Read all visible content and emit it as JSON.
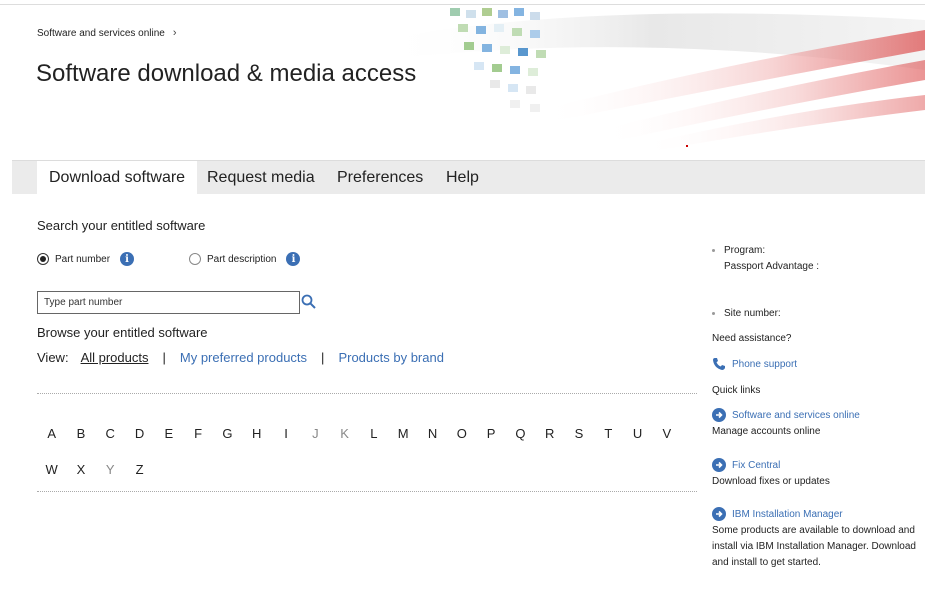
{
  "header": {
    "breadcrumb": "Software and services online",
    "title": "Software download & media access"
  },
  "tabs": [
    {
      "label": "Download software",
      "active": true
    },
    {
      "label": "Request media"
    },
    {
      "label": "Preferences"
    },
    {
      "label": "Help"
    }
  ],
  "search": {
    "heading": "Search your entitled software",
    "options": [
      {
        "label": "Part number",
        "selected": true
      },
      {
        "label": "Part description",
        "selected": false
      }
    ],
    "placeholder": "Type part number"
  },
  "browse": {
    "heading": "Browse your entitled software",
    "view_label": "View:",
    "views": [
      "All products",
      "My preferred products",
      "Products by brand"
    ],
    "letters_row1": [
      "A",
      "B",
      "C",
      "D",
      "E",
      "F",
      "G",
      "H",
      "I",
      "J",
      "K",
      "L",
      "M",
      "N",
      "O",
      "P",
      "Q",
      "R",
      "S",
      "T",
      "U",
      "V"
    ],
    "letters_row2": [
      "W",
      "X",
      "Y",
      "Z"
    ]
  },
  "sidebar": {
    "program_label": "Program:",
    "program_value": "Passport Advantage :",
    "site_label": "Site number:",
    "assistance": "Need assistance?",
    "phone_support": "Phone support",
    "quick_links": "Quick links",
    "links": [
      {
        "label": "Software and services online",
        "desc": "Manage accounts online"
      },
      {
        "label": "Fix Central",
        "desc": "Download fixes or updates"
      },
      {
        "label": "IBM Installation Manager",
        "desc": "Some products are available to download and install via IBM Installation Manager. Download and install to get started."
      }
    ]
  },
  "colors": {
    "link": "#3b6fb4",
    "tab_bar": "#ebebeb"
  }
}
